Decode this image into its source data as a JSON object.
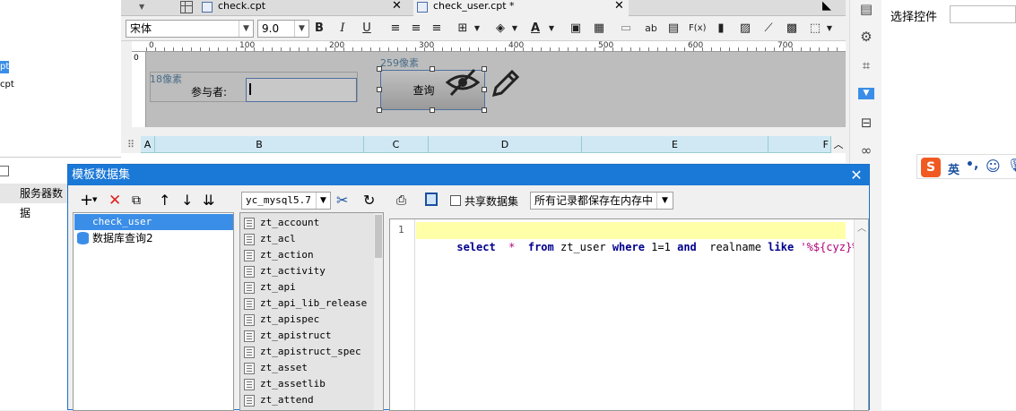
{
  "left_sidebar": {
    "item1": "pt",
    "item2": "cpt",
    "item3": "服务器数据"
  },
  "tabs": [
    {
      "label": "check.cpt"
    },
    {
      "label": "check_user.cpt *"
    }
  ],
  "toolbar": {
    "font_name": "宋体",
    "font_size": "9.0",
    "bold": "B",
    "italic": "I",
    "underline": "U",
    "text_color": "A",
    "ab_label": "ab",
    "formula_label": "F(x)"
  },
  "ruler": {
    "labels": [
      "0",
      "100",
      "200",
      "300",
      "400",
      "500",
      "600",
      "700"
    ]
  },
  "canvas": {
    "width_label": "259像素",
    "height_label": "18像素",
    "field_label": "参与者:",
    "query_button": "查询"
  },
  "sheet": {
    "columns": [
      "A",
      "B",
      "C",
      "D",
      "E",
      "F"
    ]
  },
  "right_panel": {
    "title": "选择控件"
  },
  "ime": {
    "label": "英"
  },
  "dialog": {
    "title": "模板数据集",
    "datasets": [
      {
        "label": "check_user",
        "selected": true
      },
      {
        "label": "数据库查询2",
        "selected": false
      }
    ],
    "connection": "yc_mysql5.7",
    "tables": [
      "zt_account",
      "zt_acl",
      "zt_action",
      "zt_activity",
      "zt_api",
      "zt_api_lib_release",
      "zt_apispec",
      "zt_apistruct",
      "zt_apistruct_spec",
      "zt_asset",
      "zt_assetlib",
      "zt_attend"
    ],
    "shared_checkbox_label": "共享数据集",
    "cache_option": "所有记录都保存在内存中",
    "sql": {
      "line_number": "1",
      "kw1": "select",
      "star": "*",
      "kw2": "from",
      "table": "zt_user",
      "kw3": "where",
      "cond": "1=1",
      "kw4": "and",
      "field": "realname",
      "kw5": "like",
      "pattern": "'%${cyz}%'"
    }
  }
}
